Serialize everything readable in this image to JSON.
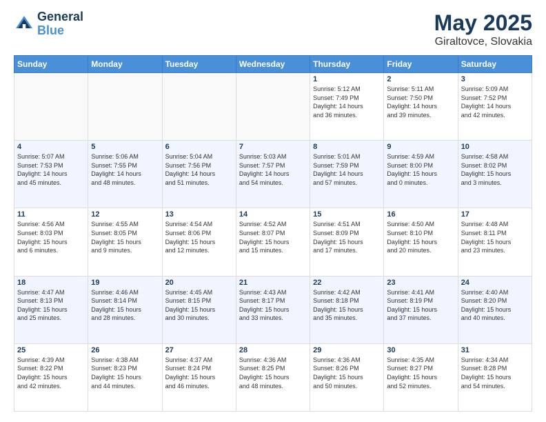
{
  "header": {
    "logo_line1": "General",
    "logo_line2": "Blue",
    "month": "May 2025",
    "location": "Giraltovce, Slovakia"
  },
  "weekdays": [
    "Sunday",
    "Monday",
    "Tuesday",
    "Wednesday",
    "Thursday",
    "Friday",
    "Saturday"
  ],
  "weeks": [
    [
      {
        "day": "",
        "info": ""
      },
      {
        "day": "",
        "info": ""
      },
      {
        "day": "",
        "info": ""
      },
      {
        "day": "",
        "info": ""
      },
      {
        "day": "1",
        "info": "Sunrise: 5:12 AM\nSunset: 7:49 PM\nDaylight: 14 hours\nand 36 minutes."
      },
      {
        "day": "2",
        "info": "Sunrise: 5:11 AM\nSunset: 7:50 PM\nDaylight: 14 hours\nand 39 minutes."
      },
      {
        "day": "3",
        "info": "Sunrise: 5:09 AM\nSunset: 7:52 PM\nDaylight: 14 hours\nand 42 minutes."
      }
    ],
    [
      {
        "day": "4",
        "info": "Sunrise: 5:07 AM\nSunset: 7:53 PM\nDaylight: 14 hours\nand 45 minutes."
      },
      {
        "day": "5",
        "info": "Sunrise: 5:06 AM\nSunset: 7:55 PM\nDaylight: 14 hours\nand 48 minutes."
      },
      {
        "day": "6",
        "info": "Sunrise: 5:04 AM\nSunset: 7:56 PM\nDaylight: 14 hours\nand 51 minutes."
      },
      {
        "day": "7",
        "info": "Sunrise: 5:03 AM\nSunset: 7:57 PM\nDaylight: 14 hours\nand 54 minutes."
      },
      {
        "day": "8",
        "info": "Sunrise: 5:01 AM\nSunset: 7:59 PM\nDaylight: 14 hours\nand 57 minutes."
      },
      {
        "day": "9",
        "info": "Sunrise: 4:59 AM\nSunset: 8:00 PM\nDaylight: 15 hours\nand 0 minutes."
      },
      {
        "day": "10",
        "info": "Sunrise: 4:58 AM\nSunset: 8:02 PM\nDaylight: 15 hours\nand 3 minutes."
      }
    ],
    [
      {
        "day": "11",
        "info": "Sunrise: 4:56 AM\nSunset: 8:03 PM\nDaylight: 15 hours\nand 6 minutes."
      },
      {
        "day": "12",
        "info": "Sunrise: 4:55 AM\nSunset: 8:05 PM\nDaylight: 15 hours\nand 9 minutes."
      },
      {
        "day": "13",
        "info": "Sunrise: 4:54 AM\nSunset: 8:06 PM\nDaylight: 15 hours\nand 12 minutes."
      },
      {
        "day": "14",
        "info": "Sunrise: 4:52 AM\nSunset: 8:07 PM\nDaylight: 15 hours\nand 15 minutes."
      },
      {
        "day": "15",
        "info": "Sunrise: 4:51 AM\nSunset: 8:09 PM\nDaylight: 15 hours\nand 17 minutes."
      },
      {
        "day": "16",
        "info": "Sunrise: 4:50 AM\nSunset: 8:10 PM\nDaylight: 15 hours\nand 20 minutes."
      },
      {
        "day": "17",
        "info": "Sunrise: 4:48 AM\nSunset: 8:11 PM\nDaylight: 15 hours\nand 23 minutes."
      }
    ],
    [
      {
        "day": "18",
        "info": "Sunrise: 4:47 AM\nSunset: 8:13 PM\nDaylight: 15 hours\nand 25 minutes."
      },
      {
        "day": "19",
        "info": "Sunrise: 4:46 AM\nSunset: 8:14 PM\nDaylight: 15 hours\nand 28 minutes."
      },
      {
        "day": "20",
        "info": "Sunrise: 4:45 AM\nSunset: 8:15 PM\nDaylight: 15 hours\nand 30 minutes."
      },
      {
        "day": "21",
        "info": "Sunrise: 4:43 AM\nSunset: 8:17 PM\nDaylight: 15 hours\nand 33 minutes."
      },
      {
        "day": "22",
        "info": "Sunrise: 4:42 AM\nSunset: 8:18 PM\nDaylight: 15 hours\nand 35 minutes."
      },
      {
        "day": "23",
        "info": "Sunrise: 4:41 AM\nSunset: 8:19 PM\nDaylight: 15 hours\nand 37 minutes."
      },
      {
        "day": "24",
        "info": "Sunrise: 4:40 AM\nSunset: 8:20 PM\nDaylight: 15 hours\nand 40 minutes."
      }
    ],
    [
      {
        "day": "25",
        "info": "Sunrise: 4:39 AM\nSunset: 8:22 PM\nDaylight: 15 hours\nand 42 minutes."
      },
      {
        "day": "26",
        "info": "Sunrise: 4:38 AM\nSunset: 8:23 PM\nDaylight: 15 hours\nand 44 minutes."
      },
      {
        "day": "27",
        "info": "Sunrise: 4:37 AM\nSunset: 8:24 PM\nDaylight: 15 hours\nand 46 minutes."
      },
      {
        "day": "28",
        "info": "Sunrise: 4:36 AM\nSunset: 8:25 PM\nDaylight: 15 hours\nand 48 minutes."
      },
      {
        "day": "29",
        "info": "Sunrise: 4:36 AM\nSunset: 8:26 PM\nDaylight: 15 hours\nand 50 minutes."
      },
      {
        "day": "30",
        "info": "Sunrise: 4:35 AM\nSunset: 8:27 PM\nDaylight: 15 hours\nand 52 minutes."
      },
      {
        "day": "31",
        "info": "Sunrise: 4:34 AM\nSunset: 8:28 PM\nDaylight: 15 hours\nand 54 minutes."
      }
    ]
  ]
}
